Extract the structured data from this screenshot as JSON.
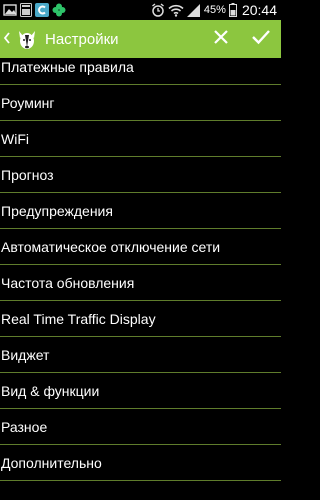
{
  "status_bar": {
    "time": "20:44",
    "battery_percent": "45%",
    "icons": [
      "picture-icon",
      "beta-badge-icon",
      "app-c-icon",
      "clover-icon",
      "alarm-icon",
      "wifi-icon",
      "signal-icon",
      "battery-icon"
    ]
  },
  "action_bar": {
    "title": "Настройки",
    "background": "#8cc63f",
    "back_icon": "chevron-left-icon",
    "logo_icon": "dog-logo-icon",
    "cancel_icon": "close-icon",
    "confirm_icon": "checkmark-icon"
  },
  "settings": {
    "items": [
      "Платежные правила",
      "Роуминг",
      "WiFi",
      "Прогноз",
      "Предупреждения",
      "Автоматическое отключение сети",
      "Частота обновления",
      "Real Time Traffic Display",
      "Виджет",
      "Вид & функции",
      "Разное",
      "Дополнительно"
    ],
    "divider_color": "#5f7c2c"
  }
}
